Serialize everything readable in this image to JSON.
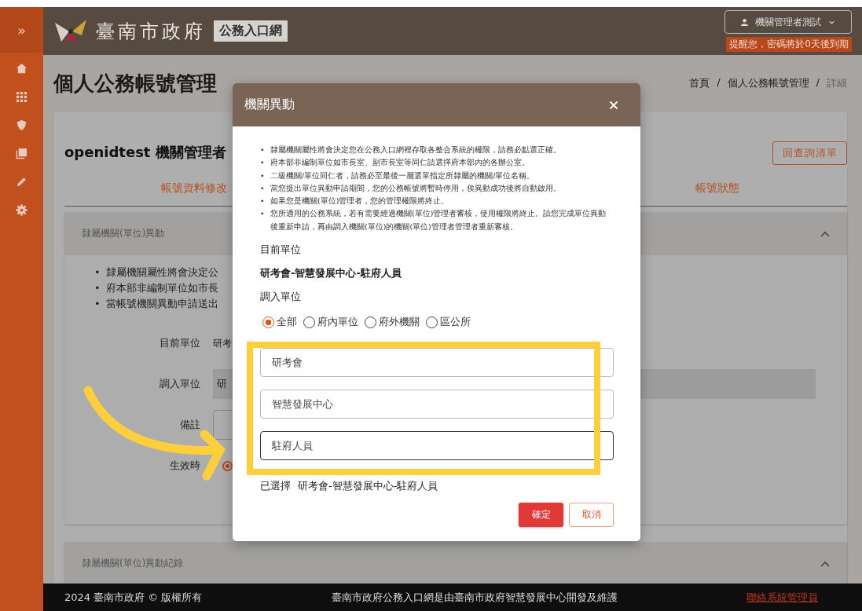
{
  "sidebar": {
    "toggle": "»"
  },
  "header": {
    "site_name": "臺南市政府",
    "portal_name": "公務入口網",
    "user_menu": "機關管理者測試",
    "password_notice": "提醒您，密碼將於0天後到期"
  },
  "page": {
    "title": "個人公務帳號管理",
    "separator": "/",
    "breadcrumb": [
      {
        "label": "首頁",
        "current": false
      },
      {
        "label": "個人公務帳號管理",
        "current": false
      },
      {
        "label": "詳細",
        "current": true
      }
    ]
  },
  "card": {
    "title": "openidtest 機關管理者",
    "back_button": "回查詢清單",
    "tabs": [
      {
        "label": "帳號資料修改"
      },
      {
        "label": "帳號狀態"
      }
    ]
  },
  "sections": [
    {
      "title": "隸屬機關(單位)異動",
      "expanded": true,
      "notes": [
        "隸屬機關屬性將會決定公",
        "府本部非編制單位如市長",
        "當帳號機關異動申請送出"
      ],
      "bullet": "•",
      "fields": [
        {
          "label": "目前單位",
          "kind": "text",
          "value": "研考"
        },
        {
          "label": "調入單位",
          "kind": "readonly",
          "value": "研"
        },
        {
          "label": "備註",
          "kind": "input"
        },
        {
          "label": "生效時",
          "kind": "radio",
          "selected": true
        }
      ]
    },
    {
      "title": "隸屬機關(單位)異動紀錄",
      "expanded": true
    }
  ],
  "footer": {
    "copyright": "2024 臺南市政府 © 版權所有",
    "credit": "臺南市政府公務入口網是由臺南市政府智慧發展中心開發及維護",
    "contact_link": "聯絡系統管理員"
  },
  "dialog": {
    "title": "機關異動",
    "bullet": "•",
    "notes": [
      "隸屬機關屬性將會決定您在公務入口網裡存取各整合系統的權限，請務必點選正確。",
      "府本部非編制單位如市長室、副市長室等同仁請選擇府本部內的各辦公室。",
      "二級機關/單位同仁者，請務必至最後一層選單指定所隸屬的機關/單位名稱。",
      "當您提出單位異動申請期間，您的公務帳號將暫時停用，俟異動成功後將自動啟用。",
      "如果您是機關(單位)管理者，您的管理權限將終止。",
      "您所適用的公務系統，若有需要經過機關(單位)管理者審核，使用權限將終止。請您完成單位異動後重新申請，再由調入機關(單位)的機關(單位)管理者管理者重新審核。"
    ],
    "current_label": "目前單位",
    "current_value": "研考會-智慧發展中心-駐府人員",
    "target_label": "調入單位",
    "filters": [
      {
        "label": "全部",
        "selected": true
      },
      {
        "label": "府內單位",
        "selected": false
      },
      {
        "label": "府外機關",
        "selected": false
      },
      {
        "label": "區公所",
        "selected": false
      }
    ],
    "selects": [
      {
        "value": "研考會",
        "focused": false
      },
      {
        "value": "智慧發展中心",
        "focused": false
      },
      {
        "value": "駐府人員",
        "focused": true
      }
    ],
    "selected_label": "已選擇",
    "selected_value": "研考會-智慧發展中心-駐府人員",
    "buttons": [
      {
        "label": "確定",
        "kind": "primary"
      },
      {
        "label": "取消",
        "kind": "outline"
      }
    ]
  }
}
